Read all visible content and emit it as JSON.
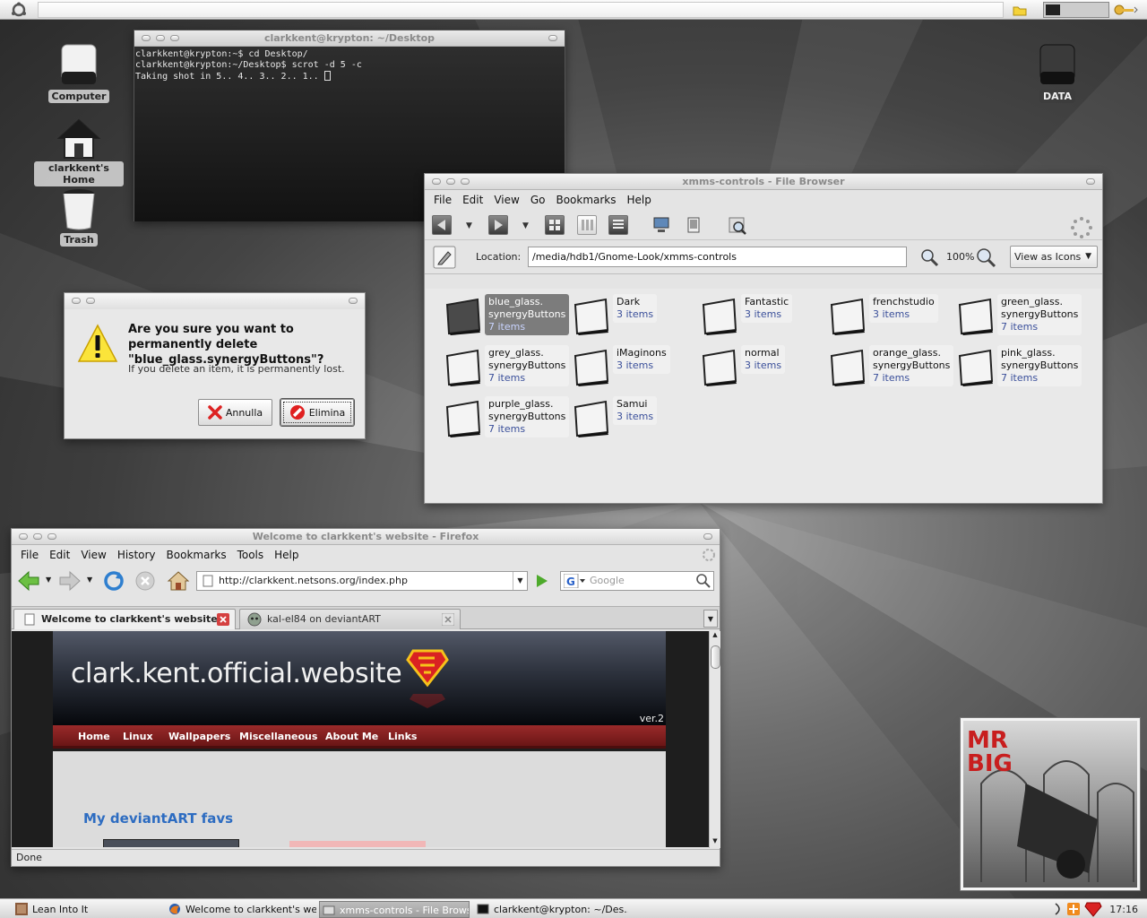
{
  "desktop": {
    "icons": [
      {
        "label": "Computer"
      },
      {
        "label": "clarkkent's Home"
      },
      {
        "label": "Trash"
      },
      {
        "label": "DATA"
      }
    ]
  },
  "terminal": {
    "title": "clarkkent@krypton: ~/Desktop",
    "lines": [
      "clarkkent@krypton:~$ cd Desktop/",
      "clarkkent@krypton:~/Desktop$ scrot -d 5 -c",
      "Taking shot in 5.. 4.. 3.. 2.. 1.. "
    ]
  },
  "dialog": {
    "heading": "Are you sure you want to permanently delete \"blue_glass.synergyButtons\"?",
    "message": "If you delete an item, it is permanently lost.",
    "cancel_label": "Annulla",
    "delete_label": "Elimina"
  },
  "filebrowser": {
    "title": "xmms-controls - File Browser",
    "menu": [
      "File",
      "Edit",
      "View",
      "Go",
      "Bookmarks",
      "Help"
    ],
    "location_label": "Location:",
    "location_value": "/media/hdb1/Gnome-Look/xmms-controls",
    "zoom": "100%",
    "view_mode": "View as Icons",
    "folders": [
      {
        "name1": "blue_glass.",
        "name2": "synergyButtons",
        "count": "7 items",
        "selected": true
      },
      {
        "name1": "Dark",
        "name2": "",
        "count": "3 items"
      },
      {
        "name1": "Fantastic",
        "name2": "",
        "count": "3 items"
      },
      {
        "name1": "frenchstudio",
        "name2": "",
        "count": "3 items"
      },
      {
        "name1": "green_glass.",
        "name2": "synergyButtons",
        "count": "7 items"
      },
      {
        "name1": "grey_glass.",
        "name2": "synergyButtons",
        "count": "7 items"
      },
      {
        "name1": "iMaginons",
        "name2": "",
        "count": "3 items"
      },
      {
        "name1": "normal",
        "name2": "",
        "count": "3 items"
      },
      {
        "name1": "orange_glass.",
        "name2": "synergyButtons",
        "count": "7 items"
      },
      {
        "name1": "pink_glass.",
        "name2": "synergyButtons",
        "count": "7 items"
      },
      {
        "name1": "purple_glass.",
        "name2": "synergyButtons",
        "count": "7 items"
      },
      {
        "name1": "Samui",
        "name2": "",
        "count": "3 items"
      }
    ]
  },
  "firefox": {
    "title": "Welcome to clarkkent's website - Firefox",
    "menu": [
      "File",
      "Edit",
      "View",
      "History",
      "Bookmarks",
      "Tools",
      "Help"
    ],
    "url": "http://clarkkent.netsons.org/index.php",
    "search_placeholder": "Google",
    "tabs": [
      "Welcome to clarkkent's website",
      "kal-el84 on deviantART"
    ],
    "status": "Done",
    "site": {
      "title": "clark.kent.official.website",
      "version": "ver.2",
      "nav": [
        "Home",
        "Linux",
        "Wallpapers",
        "Miscellaneous",
        "About Me",
        "Links"
      ],
      "section_heading": "My deviantART favs"
    }
  },
  "album": {
    "artist_line1": "MR",
    "artist_line2": "BIG"
  },
  "taskbar": {
    "tasks": [
      "Lean Into It",
      "Welcome to clarkkent's we...",
      "xmms-controls - File Brows...",
      "clarkkent@krypton: ~/Des..."
    ],
    "clock": "17:16"
  },
  "colors": {
    "accent_red": "#9a2a2a",
    "folder_count": "#3a4f9a",
    "site_heading": "#2d6cc1"
  }
}
